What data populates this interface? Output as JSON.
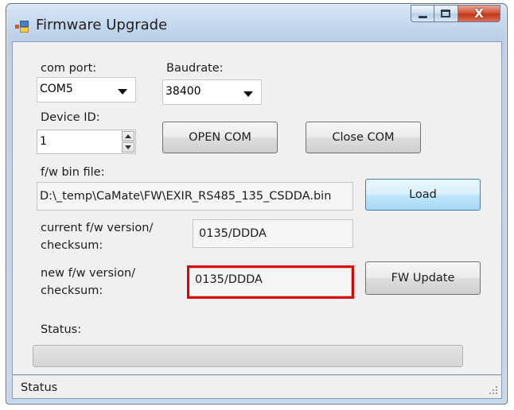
{
  "window": {
    "title": "Firmware Upgrade",
    "icons": {
      "app": "app-icon",
      "minimize": "minimize-icon",
      "maximize": "maximize-icon",
      "close": "close-icon"
    },
    "close_glyph": "X"
  },
  "form": {
    "com_port": {
      "label": "com port:",
      "value": "COM5"
    },
    "baudrate": {
      "label": "Baudrate:",
      "value": "38400"
    },
    "device_id": {
      "label": "Device ID:",
      "value": "1"
    },
    "open_com_label": "OPEN COM",
    "close_com_label": "Close COM",
    "bin_file": {
      "label": "f/w bin file:",
      "value": "D:\\_temp\\CaMate\\FW\\EXIR_RS485_135_CSDDA.bin"
    },
    "load_label": "Load",
    "current_version": {
      "label_line1": "current f/w version/",
      "label_line2": "checksum:",
      "value": "0135/DDDA"
    },
    "new_version": {
      "label_line1": "new f/w version/",
      "label_line2": "checksum:",
      "value": "0135/DDDA"
    },
    "fw_update_label": "FW Update",
    "status_label": "Status:",
    "progress_fraction": 0
  },
  "statusbar": {
    "text": "Status"
  },
  "colors": {
    "highlight": "#e00000",
    "accent_button": "#bee6fd"
  }
}
